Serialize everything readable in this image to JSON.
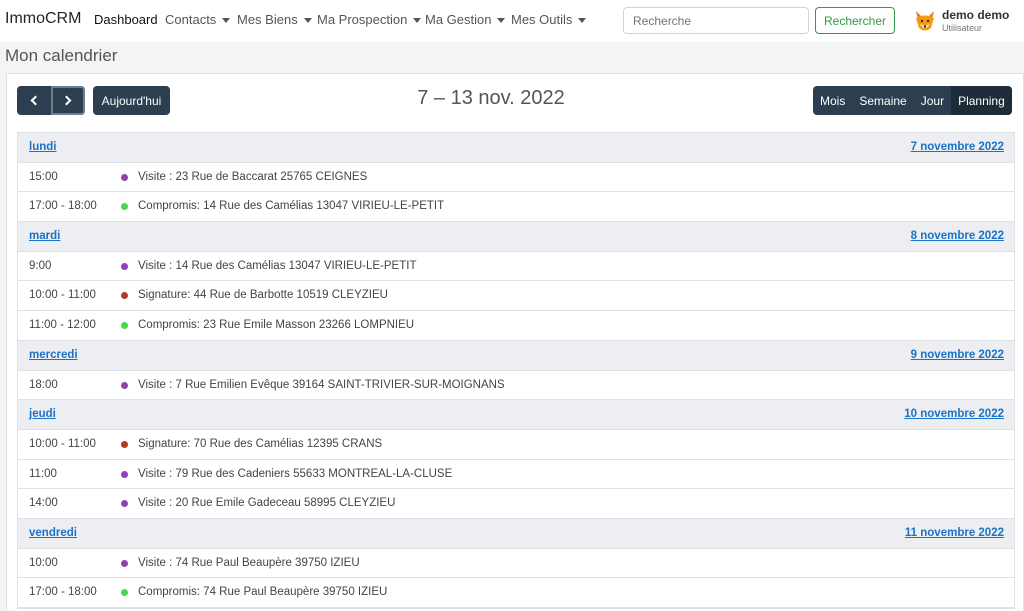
{
  "navbar": {
    "brand": "ImmoCRM",
    "items": [
      {
        "label": "Dashboard",
        "dropdown": false
      },
      {
        "label": "Contacts",
        "dropdown": true
      },
      {
        "label": "Mes Biens",
        "dropdown": true
      },
      {
        "label": "Ma Prospection",
        "dropdown": true
      },
      {
        "label": "Ma Gestion",
        "dropdown": true
      },
      {
        "label": "Mes Outils",
        "dropdown": true
      }
    ],
    "search_placeholder": "Recherche",
    "search_button": "Rechercher",
    "user": {
      "name": "demo demo",
      "role": "Utilisateur"
    }
  },
  "page_title": "Mon calendrier",
  "toolbar": {
    "today_label": "Aujourd'hui",
    "title": "7 – 13 nov. 2022",
    "views": [
      "Mois",
      "Semaine",
      "Jour",
      "Planning"
    ],
    "active_view": "Planning"
  },
  "colors": {
    "visite": "#8e44ad",
    "signature": "#b03a2e",
    "compromis": "#4cd44c",
    "primary_dark": "#2c3e50",
    "link": "#1a73c9"
  },
  "days": [
    {
      "name": "lundi",
      "date": "7 novembre 2022",
      "events": [
        {
          "time": "15:00",
          "title": "Visite : 23 Rue de Baccarat 25765 CEIGNES",
          "type": "visite"
        },
        {
          "time": "17:00 - 18:00",
          "title": "Compromis: 14 Rue des Camélias 13047 VIRIEU-LE-PETIT",
          "type": "compromis"
        }
      ]
    },
    {
      "name": "mardi",
      "date": "8 novembre 2022",
      "events": [
        {
          "time": "9:00",
          "title": "Visite : 14 Rue des Camélias 13047 VIRIEU-LE-PETIT",
          "type": "visite"
        },
        {
          "time": "10:00 - 11:00",
          "title": "Signature: 44 Rue de Barbotte 10519 CLEYZIEU",
          "type": "signature"
        },
        {
          "time": "11:00 - 12:00",
          "title": "Compromis: 23 Rue Emile Masson 23266 LOMPNIEU",
          "type": "compromis"
        }
      ]
    },
    {
      "name": "mercredi",
      "date": "9 novembre 2022",
      "events": [
        {
          "time": "18:00",
          "title": "Visite : 7 Rue Emilien Evêque 39164 SAINT-TRIVIER-SUR-MOIGNANS",
          "type": "visite"
        }
      ]
    },
    {
      "name": "jeudi",
      "date": "10 novembre 2022",
      "events": [
        {
          "time": "10:00 - 11:00",
          "title": "Signature: 70 Rue des Camélias 12395 CRANS",
          "type": "signature"
        },
        {
          "time": "11:00",
          "title": "Visite : 79 Rue des Cadeniers 55633 MONTREAL-LA-CLUSE",
          "type": "visite"
        },
        {
          "time": "14:00",
          "title": "Visite : 20 Rue Emile Gadeceau 58995 CLEYZIEU",
          "type": "visite"
        }
      ]
    },
    {
      "name": "vendredi",
      "date": "11 novembre 2022",
      "events": [
        {
          "time": "10:00",
          "title": "Visite : 74 Rue Paul Beaupère 39750 IZIEU",
          "type": "visite"
        },
        {
          "time": "17:00 - 18:00",
          "title": "Compromis: 74 Rue Paul Beaupère 39750 IZIEU",
          "type": "compromis"
        }
      ]
    }
  ]
}
